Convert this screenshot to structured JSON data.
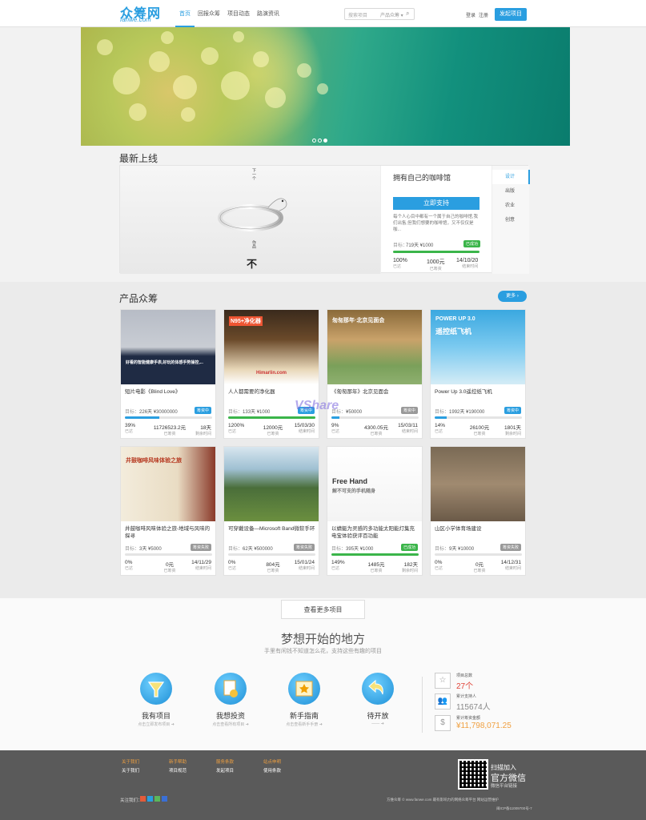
{
  "header": {
    "logo_cn": "众筹网",
    "logo_en": "fanwe.com",
    "nav": [
      "首页",
      "回报众筹",
      "项目动态",
      "路演资讯"
    ],
    "search_placeholder": "搜索项目",
    "search_type": "产品众筹 ▾",
    "login": "登录",
    "register": "注册",
    "launch": "发起项目"
  },
  "latest": {
    "section_title": "最新上线",
    "title": "拥有自己的咖啡馆",
    "support_btn": "立即支持",
    "desc": "每个人心目中都有一个属于自己的咖啡馆,我们出售,但我们想要的咖啡馆，又不仅仅是咖...",
    "goal_label": "目标：",
    "goal": "719天 ¥1000",
    "status": "已成功",
    "progress": 1.0,
    "stats": [
      {
        "v": "100%",
        "l": "已达"
      },
      {
        "v": "1000元",
        "l": "已筹资"
      },
      {
        "v": "14/10/20",
        "l": "结束时间"
      }
    ],
    "categories": [
      "设计",
      "出版",
      "农业",
      "创意"
    ],
    "image_text": [
      "作品",
      "下一个"
    ]
  },
  "products": {
    "section_title": "产品众筹",
    "more": "更多 ›",
    "cards": [
      {
        "title": "短片电影《Blind Love》",
        "goal": "226天 ¥30000000",
        "tag": "筹资中",
        "tag_color": "#2a9ee0",
        "progress": 0.39,
        "stats": [
          {
            "v": "39%",
            "l": "已达"
          },
          {
            "v": "11726523.2元",
            "l": "已筹资"
          },
          {
            "v": "18天",
            "l": "剩余时间"
          }
        ],
        "img_text": "好看的智能健康手表,好玩的体感手势操控,..."
      },
      {
        "title": "人人都需要的净化器",
        "goal": "133天 ¥1000",
        "tag": "筹资中",
        "tag_color": "#2a9ee0",
        "progress": 1.0,
        "stats": [
          {
            "v": "1200%",
            "l": "已达"
          },
          {
            "v": "12000元",
            "l": "已筹资"
          },
          {
            "v": "15/03/30",
            "l": "结束时间"
          }
        ],
        "img_text": "N95+净化器",
        "img_text2": "Himarlin.com"
      },
      {
        "title": "《匆匆那年》北京见面会",
        "goal": "¥50000",
        "tag": "筹资中",
        "tag_color": "#999999",
        "progress": 0.09,
        "stats": [
          {
            "v": "9%",
            "l": "已达"
          },
          {
            "v": "4300.05元",
            "l": "已筹资"
          },
          {
            "v": "15/03/11",
            "l": "结束时间"
          }
        ],
        "img_text": "匆匆那年·北京见面会"
      },
      {
        "title": "Power Up 3.0遥控纸飞机",
        "goal": "1992天 ¥190000",
        "tag": "筹资中",
        "tag_color": "#2a9ee0",
        "progress": 0.14,
        "stats": [
          {
            "v": "14%",
            "l": "已达"
          },
          {
            "v": "26100元",
            "l": "已筹资"
          },
          {
            "v": "1801天",
            "l": "剩余时间"
          }
        ],
        "img_text": "POWER UP 3.0",
        "img_text2": "遥控纸飞机"
      },
      {
        "title": "井鼓咖啡风味体验之旅-地域与风味的探寻",
        "goal": "3天 ¥5000",
        "tag": "筹资失败",
        "tag_color": "#999999",
        "progress": 0.0,
        "stats": [
          {
            "v": "0%",
            "l": "已达"
          },
          {
            "v": "0元",
            "l": "已筹资"
          },
          {
            "v": "14/11/29",
            "l": "结束时间"
          }
        ],
        "img_text": "井鼓咖啡风味体验之旅"
      },
      {
        "title": "可穿戴设备—Microsoft Band微软手环",
        "goal": "62天 ¥500000",
        "tag": "筹资失败",
        "tag_color": "#999999",
        "progress": 0.0,
        "stats": [
          {
            "v": "0%",
            "l": "已达"
          },
          {
            "v": "804元",
            "l": "已筹资"
          },
          {
            "v": "15/01/24",
            "l": "结束时间"
          }
        ]
      },
      {
        "title": "以蜻蜓为灵感的多功能太阳能灯集充电宝体验获评百功能",
        "goal": "395天 ¥1000",
        "tag": "已成功",
        "tag_color": "#3bb54a",
        "progress": 1.0,
        "stats": [
          {
            "v": "149%",
            "l": "已达"
          },
          {
            "v": "1485元",
            "l": "已筹资"
          },
          {
            "v": "182天",
            "l": "剩余时间"
          }
        ],
        "img_text": "Free Hand",
        "img_text2": "解不可支的手机随身"
      },
      {
        "title": "山区小学体育场建设",
        "goal": "9天 ¥10000",
        "tag": "筹资失败",
        "tag_color": "#999999",
        "progress": 0.0,
        "stats": [
          {
            "v": "0%",
            "l": "已达"
          },
          {
            "v": "0元",
            "l": "已筹资"
          },
          {
            "v": "14/12/31",
            "l": "结束时间"
          }
        ]
      }
    ]
  },
  "dream": {
    "more_btn": "查看更多项目",
    "title": "梦想开始的地方",
    "subtitle": "手里有闲钱不知道怎么花，支持这些有趣的项目",
    "items": [
      {
        "label": "我有项目",
        "sub": "点击立即发布项目 ➜"
      },
      {
        "label": "我想投资",
        "sub": "点击查看所有项目 ➜"
      },
      {
        "label": "新手指南",
        "sub": "点击查看新手手册 ➜"
      },
      {
        "label": "待开放",
        "sub": "—— ➜"
      }
    ],
    "stats": [
      {
        "label": "项目总数",
        "value": "27个",
        "color": "#e0453a"
      },
      {
        "label": "累计支持人",
        "value": "115674人",
        "color": "#888888"
      },
      {
        "label": "累计筹资金额",
        "value": "¥11,798,071.25",
        "color": "#f0a040"
      }
    ]
  },
  "footer": {
    "cols": [
      {
        "h": "关于我们",
        "i": "关于我们"
      },
      {
        "h": "新手帮助",
        "i": "项目规范"
      },
      {
        "h": "服务条款",
        "i": "发起项目"
      },
      {
        "h": "站点申明",
        "i": "使用条款"
      }
    ],
    "follow": "关注我们：",
    "qr_title": "扫描加入",
    "qr_big": "官方微信",
    "qr_sub": "微信平台链接",
    "copyright": "方维众筹 © www.fanwe.com 最有影响力的网络众筹平台 网站运营维护",
    "icp": "闽ICP备11009700号-7"
  },
  "watermark": "VShare"
}
